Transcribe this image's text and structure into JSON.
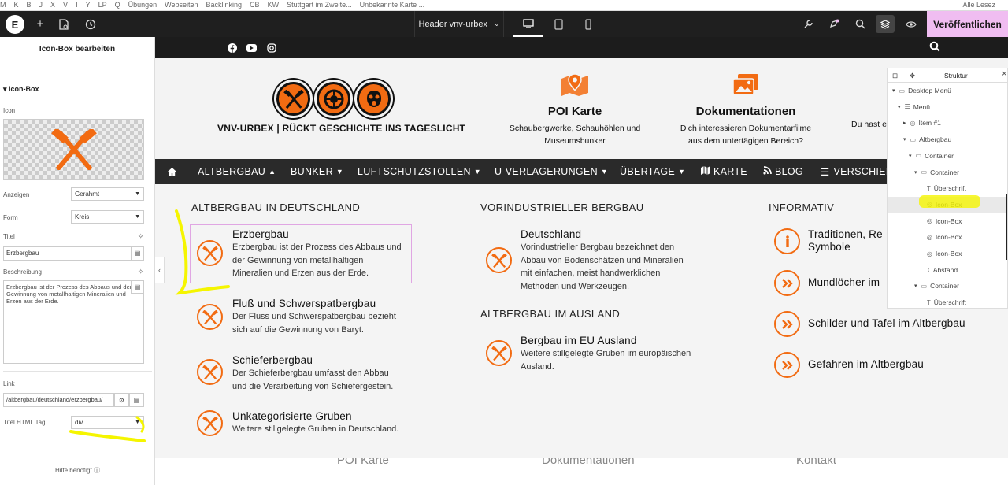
{
  "bookmarks": {
    "items": [
      "M",
      "K",
      "B",
      "J",
      "X",
      "V",
      "I",
      "Y",
      "LP",
      "Q",
      "Übungen",
      "Webseiten",
      "Backlinking",
      "CB",
      "KW",
      "Stuttgart im Zweite...",
      "Unbekannte Karte ..."
    ],
    "right": "Alle Lesez"
  },
  "editor_topbar": {
    "logo": "E",
    "document_title": "Header vnv-urbex",
    "publish_label": "Veröffentlichen",
    "icons": [
      "elementor-logo-icon",
      "add-icon",
      "page-icon",
      "history-icon",
      "desktop-icon",
      "tablet-icon",
      "mobile-icon",
      "wrench-icon",
      "notifications-icon",
      "search-icon",
      "layers-icon",
      "preview-icon"
    ]
  },
  "left_panel": {
    "title": "Icon-Box bearbeiten",
    "section": "Icon-Box",
    "icon_label": "Icon",
    "view_label": "Anzeigen",
    "view_value": "Gerahmt",
    "shape_label": "Form",
    "shape_value": "Kreis",
    "title_label": "Titel",
    "title_value": "Erzbergbau",
    "desc_label": "Beschreibung",
    "desc_value": "Erzbergbau ist der Prozess des Abbaus und der Gewinnung von metallhaltigen Mineralien und Erzen aus der Erde.",
    "link_label": "Link",
    "link_value": "/altbergbau/deutschland/erzbergbau/",
    "html_tag_label": "Titel HTML Tag",
    "html_tag_value": "div",
    "help": "Hilfe benötigt",
    "accent_color": "#f26b12"
  },
  "site": {
    "social_icons": [
      "facebook-icon",
      "youtube-icon",
      "instagram-icon"
    ],
    "tagline": "VNV-URBEX | RÜCKT GESCHICHTE INS TAGESLICHT",
    "header_boxes": [
      {
        "title": "POI Karte",
        "line1": "Schaubergwerke, Schauhöhlen und",
        "line2": "Museumsbunker"
      },
      {
        "title": "Dokumentationen",
        "line1": "Dich interessieren Dokumentarfilme",
        "line2": "aus dem untertägigen Bereich?"
      },
      {
        "title": "",
        "line1": "Du hast e",
        "line2": ""
      }
    ],
    "nav": [
      "ALTBERGBAU",
      "BUNKER",
      "LUFTSCHUTZSTOLLEN",
      "U-VERLAGERUNGEN",
      "ÜBERTAGE",
      "KARTE",
      "BLOG",
      "VERSCHIED"
    ],
    "columns": {
      "col1_heading": "ALTBERGBAU IN DEUTSCHLAND",
      "col1": [
        {
          "title": "Erzbergbau",
          "desc": [
            "Erzbergbau ist der Prozess des Abbaus und",
            "der Gewinnung von metallhaltigen",
            "Mineralien und Erzen aus der Erde."
          ]
        },
        {
          "title": "Fluß und Schwerspatbergbau",
          "desc": [
            "Der Fluss und Schwerspatbergbau bezieht",
            "sich auf die Gewinnung von Baryt."
          ]
        },
        {
          "title": "Schieferbergbau",
          "desc": [
            "Der Schieferbergbau umfasst den Abbau",
            "und die Verarbeitung von Schiefergestein."
          ]
        },
        {
          "title": "Unkategorisierte Gruben",
          "desc": [
            "Weitere stillgelegte Gruben in Deutschland."
          ]
        }
      ],
      "col2_heading": "VORINDUSTRIELLER BERGBAU",
      "col2": [
        {
          "title": "Deutschland",
          "desc": [
            "Vorindustrieller Bergbau bezeichnet den",
            "Abbau von Bodenschätzen und Mineralien",
            "mit einfachen, meist handwerklichen",
            "Methoden und Werkzeugen."
          ]
        }
      ],
      "col2b_heading": "ALTBERGBAU IM AUSLAND",
      "col2b": [
        {
          "title": "Bergbau im EU Ausland",
          "desc": [
            "Weitere stillgelegte Gruben im europäischen",
            "Ausland."
          ]
        }
      ],
      "col3_heading": "INFORMATIV",
      "col3": [
        {
          "title1": "Traditionen, Re",
          "title2": "Symbole"
        },
        {
          "title1": "Mundlöcher im",
          "title2": ""
        },
        {
          "title1": "Schilder und Tafel im Altbergbau",
          "title2": ""
        },
        {
          "title1": "Gefahren im Altbergbau",
          "title2": ""
        }
      ]
    },
    "footer_links": [
      "POI Karte",
      "Dokumentationen",
      "Kontakt"
    ]
  },
  "structure_panel": {
    "title": "Struktur",
    "items": [
      {
        "label": "Desktop Menü",
        "indent": 0,
        "arrow": "▾"
      },
      {
        "label": "Menü",
        "indent": 1,
        "arrow": "▾"
      },
      {
        "label": "Item #1",
        "indent": 2,
        "arrow": "▸"
      },
      {
        "label": "Altbergbau",
        "indent": 2,
        "arrow": "▾"
      },
      {
        "label": "Container",
        "indent": 3,
        "arrow": "▾"
      },
      {
        "label": "Container",
        "indent": 4,
        "arrow": "▾"
      },
      {
        "label": "Überschrift",
        "indent": 5,
        "arrow": ""
      },
      {
        "label": "Icon-Box",
        "indent": 5,
        "arrow": "",
        "active": true
      },
      {
        "label": "Icon-Box",
        "indent": 5,
        "arrow": ""
      },
      {
        "label": "Icon-Box",
        "indent": 5,
        "arrow": ""
      },
      {
        "label": "Icon-Box",
        "indent": 5,
        "arrow": ""
      },
      {
        "label": "Abstand",
        "indent": 5,
        "arrow": ""
      },
      {
        "label": "Container",
        "indent": 4,
        "arrow": "▾"
      },
      {
        "label": "Überschrift",
        "indent": 5,
        "arrow": ""
      }
    ]
  }
}
